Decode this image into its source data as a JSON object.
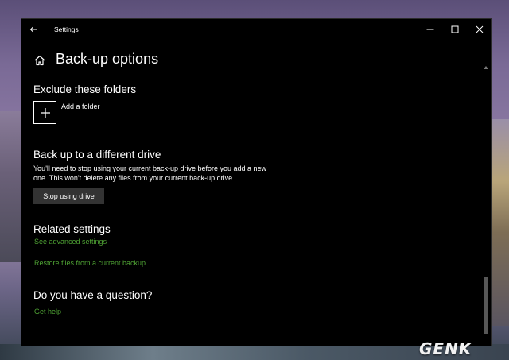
{
  "window": {
    "title": "Settings"
  },
  "page": {
    "title": "Back-up options"
  },
  "exclude": {
    "heading": "Exclude these folders",
    "add_label": "Add a folder"
  },
  "different_drive": {
    "heading": "Back up to a different drive",
    "description": "You'll need to stop using your current back-up drive before you add a new one. This won't delete any files from your current back-up drive.",
    "button_label": "Stop using drive"
  },
  "related": {
    "heading": "Related settings",
    "links": [
      "See advanced settings",
      "Restore files from a current backup"
    ]
  },
  "question": {
    "heading": "Do you have a question?",
    "link": "Get help"
  },
  "watermark": "GENK",
  "colors": {
    "window_bg": "#000000",
    "text": "#ffffff",
    "link": "#4fa334",
    "button_bg": "#333333",
    "scroll_thumb": "#575757"
  },
  "icons": {
    "titlebar_back": "back-arrow-icon",
    "home": "home-icon",
    "add": "plus-icon",
    "minimize": "minimize-icon",
    "maximize": "maximize-icon",
    "close": "close-icon"
  }
}
